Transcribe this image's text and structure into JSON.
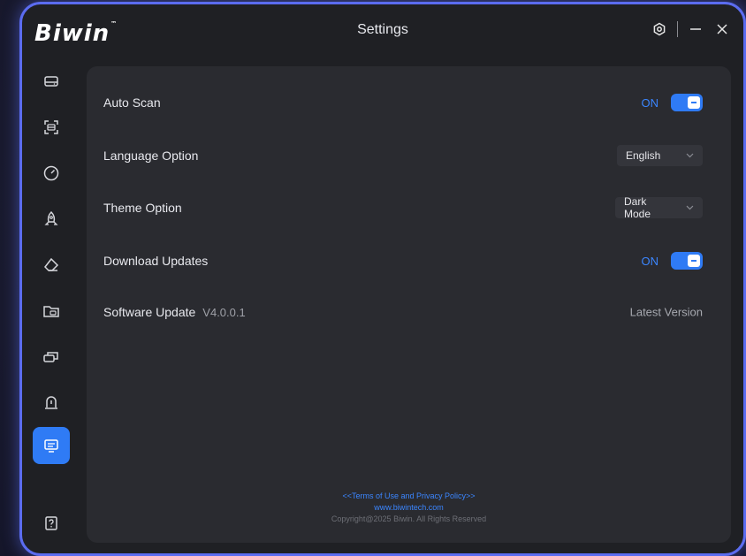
{
  "app": {
    "logo": "Biwin",
    "logo_tm": "™",
    "title": "Settings"
  },
  "window_controls": {
    "icons": [
      "settings-icon",
      "minimize-icon",
      "close-icon"
    ]
  },
  "sidebar": {
    "items": [
      {
        "icon": "drive-icon",
        "active": false
      },
      {
        "icon": "scan-icon",
        "active": false
      },
      {
        "icon": "speedometer-icon",
        "active": false
      },
      {
        "icon": "rocket-icon",
        "active": false
      },
      {
        "icon": "eraser-icon",
        "active": false
      },
      {
        "icon": "folder-backup-icon",
        "active": false
      },
      {
        "icon": "clone-drive-icon",
        "active": false
      },
      {
        "icon": "alert-icon",
        "active": false
      },
      {
        "icon": "monitor-settings-icon",
        "active": true
      }
    ],
    "help_icon": "help-icon"
  },
  "settings": {
    "auto_scan": {
      "label": "Auto Scan",
      "state": "ON"
    },
    "language": {
      "label": "Language Option",
      "value": "English"
    },
    "theme": {
      "label": "Theme Option",
      "value": "Dark Mode"
    },
    "download_updates": {
      "label": "Download Updates",
      "state": "ON"
    },
    "software_update": {
      "label": "Software Update",
      "version": "V4.0.0.1",
      "status": "Latest Version"
    }
  },
  "footer": {
    "terms": "<<Terms of Use and Privacy Policy>>",
    "website": "www.biwintech.com",
    "copyright": "Copyright@2025 Biwin. All Rights Reserved"
  },
  "colors": {
    "accent": "#2f7bf5",
    "window_border": "#5b6cf0",
    "panel_bg": "#2a2b30",
    "window_bg": "#1f2024"
  }
}
